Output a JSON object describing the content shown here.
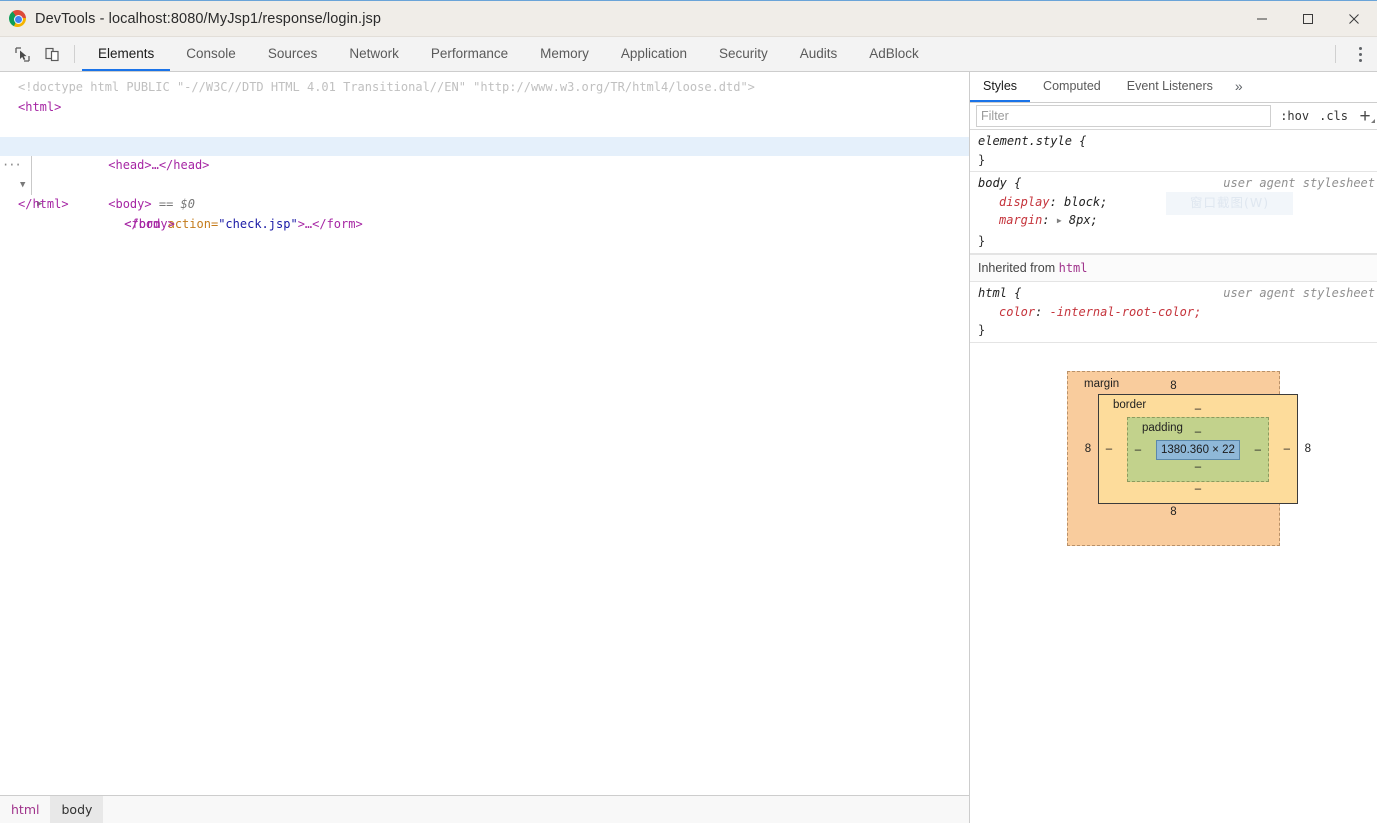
{
  "window": {
    "title": "DevTools - localhost:8080/MyJsp1/response/login.jsp",
    "minimize_label": "Minimize",
    "maximize_label": "Maximize",
    "close_label": "Close"
  },
  "toolbar": {
    "inspect_tooltip": "Inspect element",
    "device_tooltip": "Toggle device toolbar",
    "menu_tooltip": "Customize and control DevTools",
    "tabs": [
      {
        "label": "Elements",
        "active": true
      },
      {
        "label": "Console",
        "active": false
      },
      {
        "label": "Sources",
        "active": false
      },
      {
        "label": "Network",
        "active": false
      },
      {
        "label": "Performance",
        "active": false
      },
      {
        "label": "Memory",
        "active": false
      },
      {
        "label": "Application",
        "active": false
      },
      {
        "label": "Security",
        "active": false
      },
      {
        "label": "Audits",
        "active": false
      },
      {
        "label": "AdBlock",
        "active": false
      }
    ]
  },
  "dom": {
    "doctype": "<!doctype html PUBLIC \"-//W3C//DTD HTML 4.01 Transitional//EN\" \"http://www.w3.org/TR/html4/loose.dtd\">",
    "doctype_parts": {
      "prefix": "<!doctype html PUBLIC ",
      "public_id": "\"-//W3C//DTD HTML 4.01 Transitional//EN\"",
      "system_id": "\"http://www.w3.org/TR/html4/loose.dtd\"",
      "suffix": ">"
    },
    "nodes": {
      "html_open": "<html>",
      "head_collapsed": "<head>…</head>",
      "body_open": "<body>",
      "body_marker": "== $0",
      "form_tag": "<form",
      "form_attr_name": "action",
      "form_attr_value": "\"check.jsp\"",
      "form_collapsed_tail": ">…</form>",
      "body_close": "</body>",
      "html_close": "</html>"
    }
  },
  "breadcrumb": {
    "items": [
      {
        "label": "html",
        "selected": false
      },
      {
        "label": "body",
        "selected": true
      }
    ]
  },
  "styles": {
    "tabs": [
      {
        "label": "Styles",
        "active": true
      },
      {
        "label": "Computed",
        "active": false
      },
      {
        "label": "Event Listeners",
        "active": false
      }
    ],
    "more_tabs_icon": "chevron-double-right-icon",
    "filter_placeholder": "Filter",
    "filter_value": "",
    "hov_label": ":hov",
    "cls_label": ".cls",
    "new_rule_label": "+",
    "ghost_overlay_text": "窗口截图(W)",
    "rules": [
      {
        "selector": "element.style {",
        "origin": "",
        "close": "}",
        "declarations": []
      },
      {
        "selector": "body {",
        "origin": "user agent stylesheet",
        "close": "}",
        "declarations": [
          {
            "name": "display",
            "value": "block;",
            "expandable": false
          },
          {
            "name": "margin",
            "value": "8px;",
            "expandable": true
          }
        ]
      }
    ],
    "inherited_label": "Inherited from",
    "inherited_from": "html",
    "inherited_rules": [
      {
        "selector": "html {",
        "origin": "user agent stylesheet",
        "close": "}",
        "declarations": [
          {
            "name": "color",
            "value": "-internal-root-color;",
            "expandable": false,
            "value_red": true
          }
        ]
      }
    ]
  },
  "box_model": {
    "margin_label": "margin",
    "border_label": "border",
    "padding_label": "padding",
    "margin_top": "8",
    "margin_right": "8",
    "margin_bottom": "8",
    "margin_left": "8",
    "border_top": "–",
    "border_right": "–",
    "border_bottom": "–",
    "border_left": "–",
    "padding_top": "–",
    "padding_right": "–",
    "padding_bottom": "–",
    "padding_left": "–",
    "content_size": "1380.360 × 22",
    "colors": {
      "margin": "#f9cc9d",
      "border": "#fddc9b",
      "padding": "#c2d28c",
      "content": "#8fb8d8"
    }
  },
  "theme": {
    "accent": "#1a73e8",
    "titlebar_bg": "#f0ede8",
    "tabbar_bg": "#f3f3f3",
    "selected_node_bg": "#e5f0fb"
  }
}
